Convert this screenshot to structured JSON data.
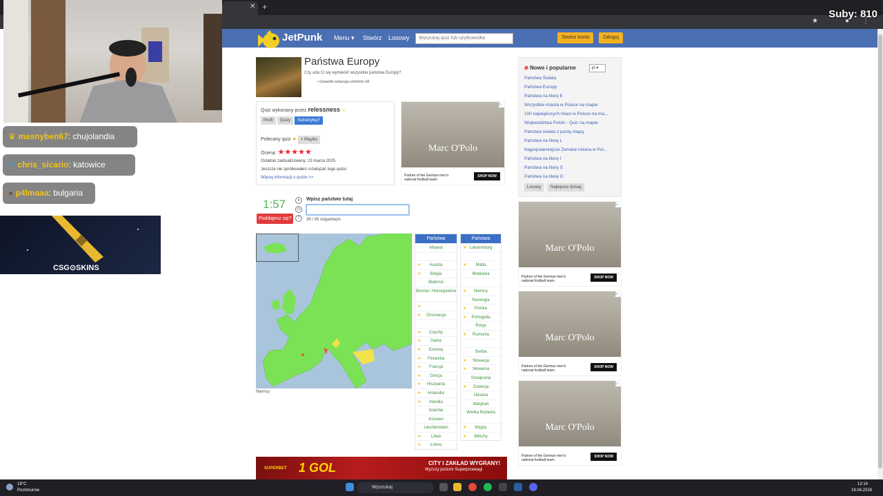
{
  "overlay": {
    "subs": "Suby: 810"
  },
  "site": {
    "logo": "JetPunk",
    "nav": [
      "Menu",
      "Stwórz",
      "Losowy"
    ],
    "search_placeholder": "Wyszukaj quiz lub użytkownika",
    "create_account": "Stwórz konto",
    "login": "Zaloguj"
  },
  "quiz": {
    "title": "Państwa Europy",
    "subtitle": "Czy uda Ci się wymienić wszystkie państwa Europy?",
    "note": "Gwiazdki wskazują członków UE",
    "made_by_prefix": "Quiz wykonany przez",
    "author": "relessness",
    "btn_profile": "Profil",
    "btn_quizzes": "Quizy",
    "btn_subscribe": "Subskrybuj?",
    "recommended": "Polecany quiz",
    "playlist": "+ Playlist",
    "rating_label": "Ocena:",
    "rating": 5,
    "updated": "Ostatnio zaktualizowany: 23 marca 2025",
    "not_tried": "Jeszcze nie spróbowałeś rozwiązać tego quizu",
    "more_info": "Więcej informacji o quizie >>",
    "timer": "1:57",
    "give_up": "Poddajesz się?",
    "type_label": "Wpisz państwo tutaj",
    "progress": "39 / 45 odgadnięto",
    "map_label": "Niemcy"
  },
  "table": {
    "header": "Państwa",
    "col1": [
      {
        "n": "Albania",
        "s": false
      },
      {
        "n": "",
        "s": false
      },
      {
        "n": "Austria",
        "s": true
      },
      {
        "n": "Belgia",
        "s": true
      },
      {
        "n": "Białoruś",
        "s": false
      },
      {
        "n": "Bośnia i Hercegowina",
        "s": false,
        "tall": true
      },
      {
        "n": "",
        "s": true
      },
      {
        "n": "Chorwacja",
        "s": true
      },
      {
        "n": "",
        "s": false
      },
      {
        "n": "Czechy",
        "s": true
      },
      {
        "n": "Dania",
        "s": true
      },
      {
        "n": "Estonia",
        "s": true
      },
      {
        "n": "Finlandia",
        "s": true
      },
      {
        "n": "Francja",
        "s": true
      },
      {
        "n": "Grecja",
        "s": true
      },
      {
        "n": "Hiszpania",
        "s": true
      },
      {
        "n": "Holandia",
        "s": true
      },
      {
        "n": "Irlandia",
        "s": true
      },
      {
        "n": "Islandia",
        "s": false
      },
      {
        "n": "Kosowo",
        "s": false
      },
      {
        "n": "Liechtenstein",
        "s": false
      },
      {
        "n": "Litwa",
        "s": true
      },
      {
        "n": "Łotwa",
        "s": true
      }
    ],
    "col2": [
      {
        "n": "Luksemburg",
        "s": true
      },
      {
        "n": "",
        "s": false
      },
      {
        "n": "Malta",
        "s": true
      },
      {
        "n": "Mołdawia",
        "s": false
      },
      {
        "n": "",
        "s": false
      },
      {
        "n": "Niemcy",
        "s": true
      },
      {
        "n": "Norwegia",
        "s": false
      },
      {
        "n": "Polska",
        "s": true
      },
      {
        "n": "Portugalia",
        "s": true
      },
      {
        "n": "Rosja",
        "s": false
      },
      {
        "n": "Rumunia",
        "s": true
      },
      {
        "n": "",
        "s": false
      },
      {
        "n": "Serbia",
        "s": false
      },
      {
        "n": "Słowacja",
        "s": true
      },
      {
        "n": "Słowenia",
        "s": true
      },
      {
        "n": "Szwajcaria",
        "s": false
      },
      {
        "n": "Szwecja",
        "s": true
      },
      {
        "n": "Ukraina",
        "s": false
      },
      {
        "n": "Watykan",
        "s": false
      },
      {
        "n": "Wielka Brytania",
        "s": false,
        "tall": true
      },
      {
        "n": "Węgry",
        "s": true
      },
      {
        "n": "Włochy",
        "s": true
      }
    ]
  },
  "sidebar": {
    "title": "Nowe i popularne",
    "lang": "pl",
    "items": [
      "Państwa Świata",
      "Państwa Europy",
      "Państwa na literę E",
      "Wszystkie miasta w Polsce na mapie",
      "100 największych miast w Polsce na ma...",
      "Województwa Polski - Quiz na mapie",
      "Państwa świata z pustą mapą",
      "Państwa na literę L",
      "Najpopularniejsze Żeńskie imiona w Pol...",
      "Państwa na literę I",
      "Państwa na literę S",
      "Państwa na literę G"
    ],
    "btn_random": "Losowy",
    "btn_best": "Najlepsze dzisiaj"
  },
  "ad": {
    "brand": "Marc O'Polo",
    "caption": "Partner of the German men's national football team.",
    "shop": "SHOP NOW"
  },
  "banner": {
    "brand": "SUPERBET",
    "headline": "1 GOL",
    "tagline": "CITY I ZAKŁAD WYGRANY!",
    "sub": "Wyższy poziom Superprzewagi"
  },
  "chat": [
    {
      "user": "masnyben67",
      "msg": "chujolandia",
      "color": "#f0c419"
    },
    {
      "user": "chris_sicario",
      "msg": "katowice",
      "color": "#f0c419"
    },
    {
      "user": "p4lmaaa",
      "msg": "bulgaria",
      "color": "#f0c419"
    }
  ],
  "csg": {
    "logo": "CSG⊙SKINS"
  },
  "taskbar": {
    "temp": "19°C",
    "weather": "Pochmurnie",
    "search": "Wyszukaj",
    "time": "12:14",
    "date": "19.04.2026"
  }
}
